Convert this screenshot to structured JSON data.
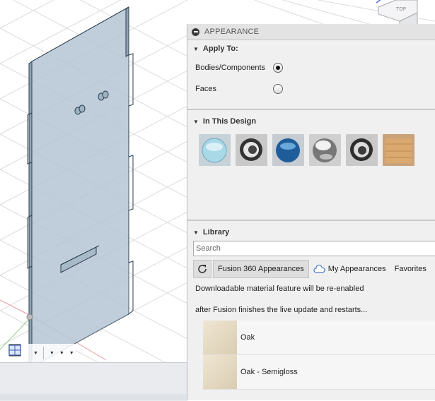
{
  "panel": {
    "title": "APPEARANCE",
    "apply_to": {
      "heading": "Apply To:",
      "options": [
        {
          "label": "Bodies/Components",
          "selected": true
        },
        {
          "label": "Faces",
          "selected": false
        }
      ]
    },
    "in_this_design": {
      "heading": "In This Design",
      "swatches": [
        "glass-clear",
        "chrome-ring",
        "glass-blue",
        "chrome-sphere",
        "chrome-ring-2",
        "oak-cube"
      ]
    },
    "library": {
      "heading": "Library",
      "search_placeholder": "Search",
      "tabs": [
        {
          "label": "Fusion 360 Appearances",
          "active": true
        },
        {
          "label": "My Appearances",
          "active": false
        },
        {
          "label": "Favorites",
          "active": false
        }
      ],
      "message_1": "Downloadable material feature will be re-enabled",
      "message_2": "after Fusion finishes the live update and restarts...",
      "materials": [
        {
          "name": "Oak"
        },
        {
          "name": "Oak - Semigloss"
        }
      ]
    }
  },
  "toolbar": {
    "icons": [
      "orbit-icon",
      "look-at-icon",
      "pan-icon",
      "zoom-icon",
      "fit-icon",
      "display-settings-icon",
      "grid-icon",
      "viewports-icon"
    ]
  },
  "viewcube": {
    "face_label": "TOP"
  },
  "colors": {
    "accent": "#1f4ea8",
    "panel_bg": "#f0f0f0",
    "body_fill": "#b4c6d4"
  }
}
